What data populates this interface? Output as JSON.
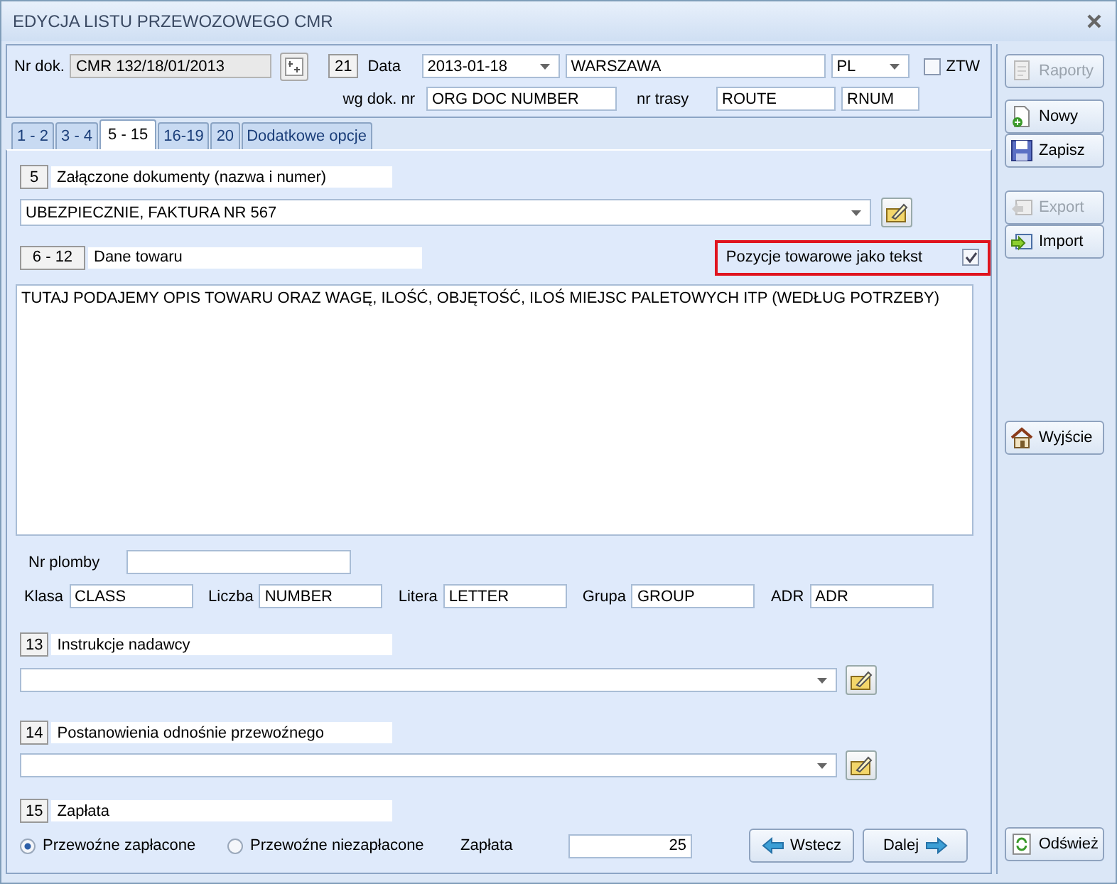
{
  "window": {
    "title": "EDYCJA LISTU PRZEWOZOWEGO CMR"
  },
  "header": {
    "doc_label": "Nr dok.",
    "doc_value": "CMR 132/18/01/2013",
    "box_number": "21",
    "date_label": "Data",
    "date_value": "2013-01-18",
    "city": "WARSZAWA",
    "country": "PL",
    "ztw": {
      "label": "ZTW",
      "checked": false
    },
    "orig_label": "wg dok. nr",
    "orig_value": "ORG DOC NUMBER",
    "route_label": "nr trasy",
    "route_value": "ROUTE",
    "route_number": "RNUM"
  },
  "tabs": [
    {
      "label": "1 - 2",
      "selected": false
    },
    {
      "label": "3 - 4",
      "selected": false
    },
    {
      "label": "5 - 15",
      "selected": true
    },
    {
      "label": "16-19",
      "selected": false
    },
    {
      "label": "20",
      "selected": false
    },
    {
      "label": "Dodatkowe opcje",
      "selected": false
    }
  ],
  "documents": {
    "number": "5",
    "title": "Załączone dokumenty (nazwa i numer)",
    "value": "UBEZPIECZNIE, FAKTURA NR 567"
  },
  "goods": {
    "number": "6 - 12",
    "title": "Dane towaru",
    "option": {
      "label": "Pozycje towarowe jako tekst",
      "checked": true,
      "highlighted": true
    },
    "text": "TUTAJ PODAJEMY OPIS TOWARU ORAZ WAGĘ, ILOŚĆ, OBJĘTOŚĆ, ILOŚ MIEJSC PALETOWYCH ITP (WEDŁUG POTRZEBY)"
  },
  "seal": {
    "label": "Nr plomby"
  },
  "adr_fields": [
    {
      "label": "Klasa",
      "value": "CLASS"
    },
    {
      "label": "Liczba",
      "value": "NUMBER"
    },
    {
      "label": "Litera",
      "value": "LETTER"
    },
    {
      "label": "Grupa",
      "value": "GROUP"
    },
    {
      "label": "ADR",
      "value": "ADR"
    }
  ],
  "sender_instructions": {
    "number": "13",
    "title": "Instrukcje nadawcy"
  },
  "carrier_provisions": {
    "number": "14",
    "title": "Postanowienia odnośnie przewoźnego"
  },
  "payment": {
    "number": "15",
    "title": "Zapłata",
    "options": [
      {
        "label": "Przewoźne zapłacone",
        "selected": true
      },
      {
        "label": "Przewoźne niezapłacone",
        "selected": false
      }
    ],
    "amount_label": "Zapłata",
    "amount_value": "25"
  },
  "nav_buttons": [
    {
      "label": "Wstecz",
      "kind": "back"
    },
    {
      "label": "Dalej",
      "kind": "next"
    }
  ],
  "side_buttons": [
    {
      "label": "Raporty",
      "kind": "reports",
      "disabled": true
    },
    {
      "label": "Nowy",
      "kind": "new",
      "disabled": false
    },
    {
      "label": "Zapisz",
      "kind": "save",
      "disabled": false
    },
    {
      "label": "Export",
      "kind": "export",
      "disabled": true
    },
    {
      "label": "Import",
      "kind": "import",
      "disabled": false
    },
    {
      "label": "Wyjście",
      "kind": "exit",
      "disabled": false
    },
    {
      "label": "Odśwież",
      "kind": "refresh",
      "disabled": false
    }
  ]
}
